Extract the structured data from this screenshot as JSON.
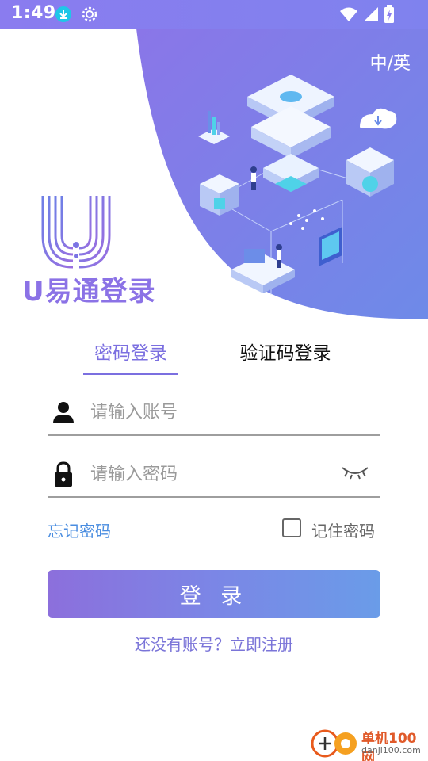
{
  "status_bar": {
    "time": "1:49",
    "icons": [
      "download-icon",
      "gear-icon",
      "wifi-icon",
      "signal-icon",
      "battery-icon"
    ]
  },
  "header": {
    "lang_switch": "中/英"
  },
  "brand": {
    "logo_text": "U易通登录"
  },
  "tabs": [
    {
      "label": "密码登录",
      "active": true
    },
    {
      "label": "验证码登录",
      "active": false
    }
  ],
  "form": {
    "account": {
      "value": "",
      "placeholder": "请输入账号",
      "icon": "person-icon"
    },
    "password": {
      "value": "",
      "placeholder": "请输入密码",
      "icon": "lock-icon",
      "toggle_icon": "eye-closed-icon"
    },
    "forgot_label": "忘记密码",
    "remember_label": "记住密码",
    "remember_checked": false,
    "login_label": "登 录",
    "register_label": "还没有账号？立即注册"
  },
  "watermark": {
    "name": "单机100网",
    "domain": "danji100.com"
  },
  "colors": {
    "accent": "#7b6fe0",
    "link": "#4a8de0",
    "hero_gradient_start": "#8a76e8",
    "hero_gradient_end": "#6e88e8"
  }
}
